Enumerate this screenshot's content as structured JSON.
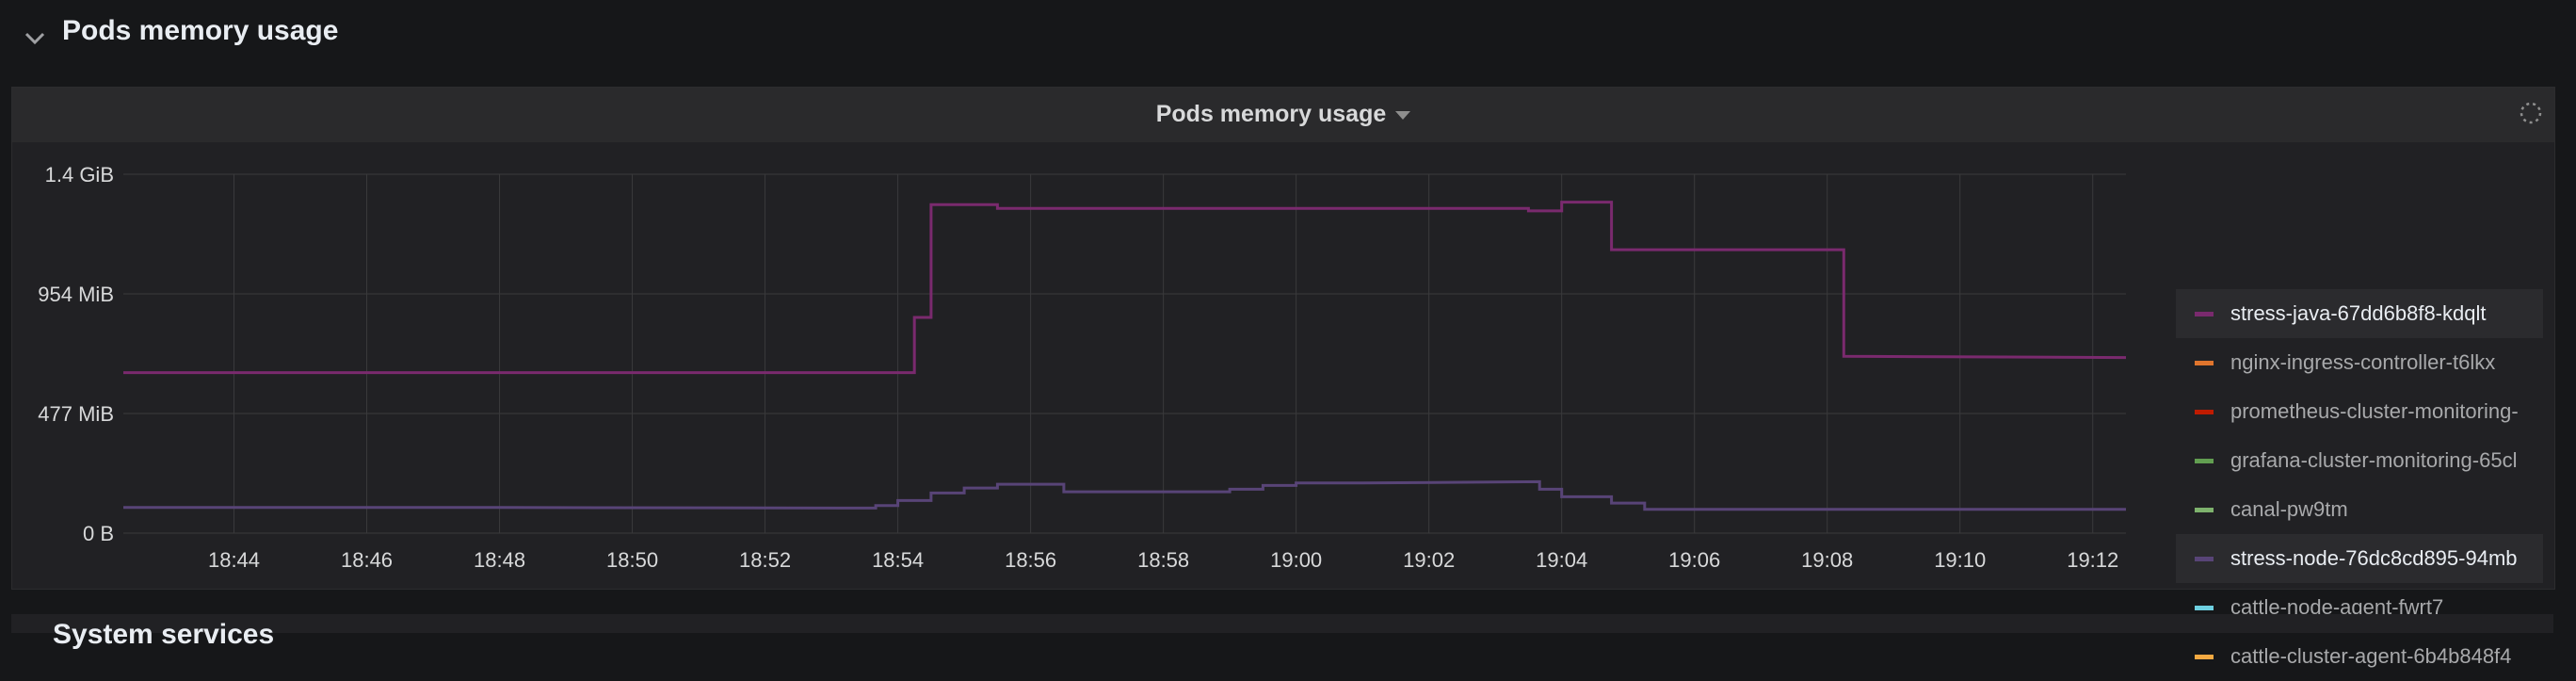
{
  "row": {
    "title": "Pods memory usage"
  },
  "panel": {
    "title": "Pods memory usage"
  },
  "next_row": {
    "title": "System services"
  },
  "colors": {
    "background": "#161719",
    "panel_bg": "#212124",
    "grid": "#3a3a3c",
    "axis_text": "#d8d9da"
  },
  "chart_data": {
    "type": "line",
    "x_ticks": [
      "18:44",
      "18:46",
      "18:48",
      "18:50",
      "18:52",
      "18:54",
      "18:56",
      "18:58",
      "19:00",
      "19:02",
      "19:04",
      "19:06",
      "19:08",
      "19:10",
      "19:12"
    ],
    "y_ticks": [
      "0 B",
      "477 MiB",
      "954 MiB",
      "1.4 GiB"
    ],
    "ylim": [
      0,
      1431
    ],
    "xlim": [
      "18:42:20",
      "19:12:30"
    ],
    "grid": true,
    "legend_position": "right",
    "series": [
      {
        "name": "stress-java-67dd6b8f8-kdqlt",
        "color": "#7a2a6e",
        "points": [
          [
            "18:42:20",
            640
          ],
          [
            "18:54:15",
            640
          ],
          [
            "18:54:15",
            860
          ],
          [
            "18:54:30",
            860
          ],
          [
            "18:54:30",
            1310
          ],
          [
            "18:55:30",
            1310
          ],
          [
            "18:55:30",
            1295
          ],
          [
            "19:03:30",
            1295
          ],
          [
            "19:03:30",
            1285
          ],
          [
            "19:04:00",
            1285
          ],
          [
            "19:04:00",
            1320
          ],
          [
            "19:04:45",
            1320
          ],
          [
            "19:04:45",
            1130
          ],
          [
            "19:08:15",
            1130
          ],
          [
            "19:08:15",
            705
          ],
          [
            "19:12:30",
            700
          ]
        ]
      },
      {
        "name": "nginx-ingress-controller-t6lkx",
        "color": "#e0752d",
        "points": []
      },
      {
        "name": "prometheus-cluster-monitoring-",
        "color": "#bf1b00",
        "points": []
      },
      {
        "name": "grafana-cluster-monitoring-65cl",
        "color": "#629e51",
        "points": []
      },
      {
        "name": "canal-pw9tm",
        "color": "#7eb26d",
        "points": []
      },
      {
        "name": "stress-node-76dc8cd895-94mb",
        "color": "#584477",
        "points": [
          [
            "18:42:20",
            102
          ],
          [
            "18:48:00",
            102
          ],
          [
            "18:53:40",
            100
          ],
          [
            "18:53:40",
            110
          ],
          [
            "18:54:00",
            110
          ],
          [
            "18:54:00",
            130
          ],
          [
            "18:54:30",
            130
          ],
          [
            "18:54:30",
            160
          ],
          [
            "18:55:00",
            160
          ],
          [
            "18:55:00",
            180
          ],
          [
            "18:55:30",
            180
          ],
          [
            "18:55:30",
            195
          ],
          [
            "18:56:30",
            195
          ],
          [
            "18:56:30",
            165
          ],
          [
            "18:59:00",
            165
          ],
          [
            "18:59:00",
            175
          ],
          [
            "18:59:30",
            175
          ],
          [
            "18:59:30",
            190
          ],
          [
            "19:00:00",
            190
          ],
          [
            "19:00:00",
            200
          ],
          [
            "19:01:00",
            200
          ],
          [
            "19:03:40",
            205
          ],
          [
            "19:03:40",
            175
          ],
          [
            "19:04:00",
            175
          ],
          [
            "19:04:00",
            145
          ],
          [
            "19:04:45",
            145
          ],
          [
            "19:04:45",
            120
          ],
          [
            "19:05:15",
            120
          ],
          [
            "19:05:15",
            95
          ],
          [
            "19:12:30",
            95
          ]
        ]
      },
      {
        "name": "cattle-node-agent-fwrt7",
        "color": "#6ed0e0",
        "points": []
      },
      {
        "name": "cattle-cluster-agent-6b4b848f4",
        "color": "#f4a941",
        "points": []
      }
    ]
  }
}
